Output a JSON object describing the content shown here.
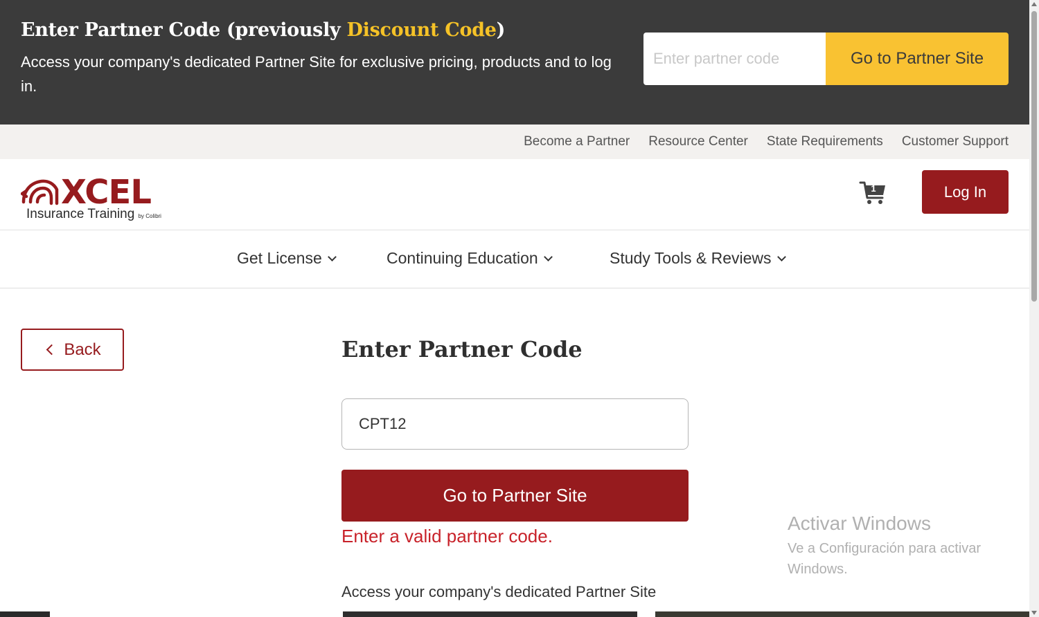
{
  "banner": {
    "title_prefix": "Enter Partner Code (previously ",
    "title_highlight": "Discount Code",
    "title_suffix": ")",
    "description": "Access your company's dedicated Partner Site for exclusive pricing, products and to log in.",
    "input_placeholder": "Enter partner code",
    "button_label": "Go to Partner Site"
  },
  "utility_nav": {
    "items": [
      "Become a Partner",
      "Resource Center",
      "State Requirements",
      "Customer Support"
    ]
  },
  "header": {
    "logo_text": "XCEL",
    "logo_tagline": "Insurance Training",
    "logo_byline": "by Colibri",
    "cart_count": "1",
    "login_label": "Log In"
  },
  "main_nav": {
    "items": [
      "Get License",
      "Continuing Education",
      "Study Tools & Reviews"
    ]
  },
  "content": {
    "back_label": "Back",
    "title": "Enter Partner Code",
    "code_value": "CPT12",
    "button_label": "Go to Partner Site",
    "error": "Enter a valid partner code.",
    "info": "Access your company's dedicated Partner Site"
  },
  "watermark": {
    "title": "Activar Windows",
    "subtitle": "Ve a Configuración para activar Windows."
  },
  "colors": {
    "brand_red": "#961b1e",
    "accent_yellow": "#f9c232",
    "banner_bg": "#3b3b3b",
    "error_red": "#c8222a"
  }
}
